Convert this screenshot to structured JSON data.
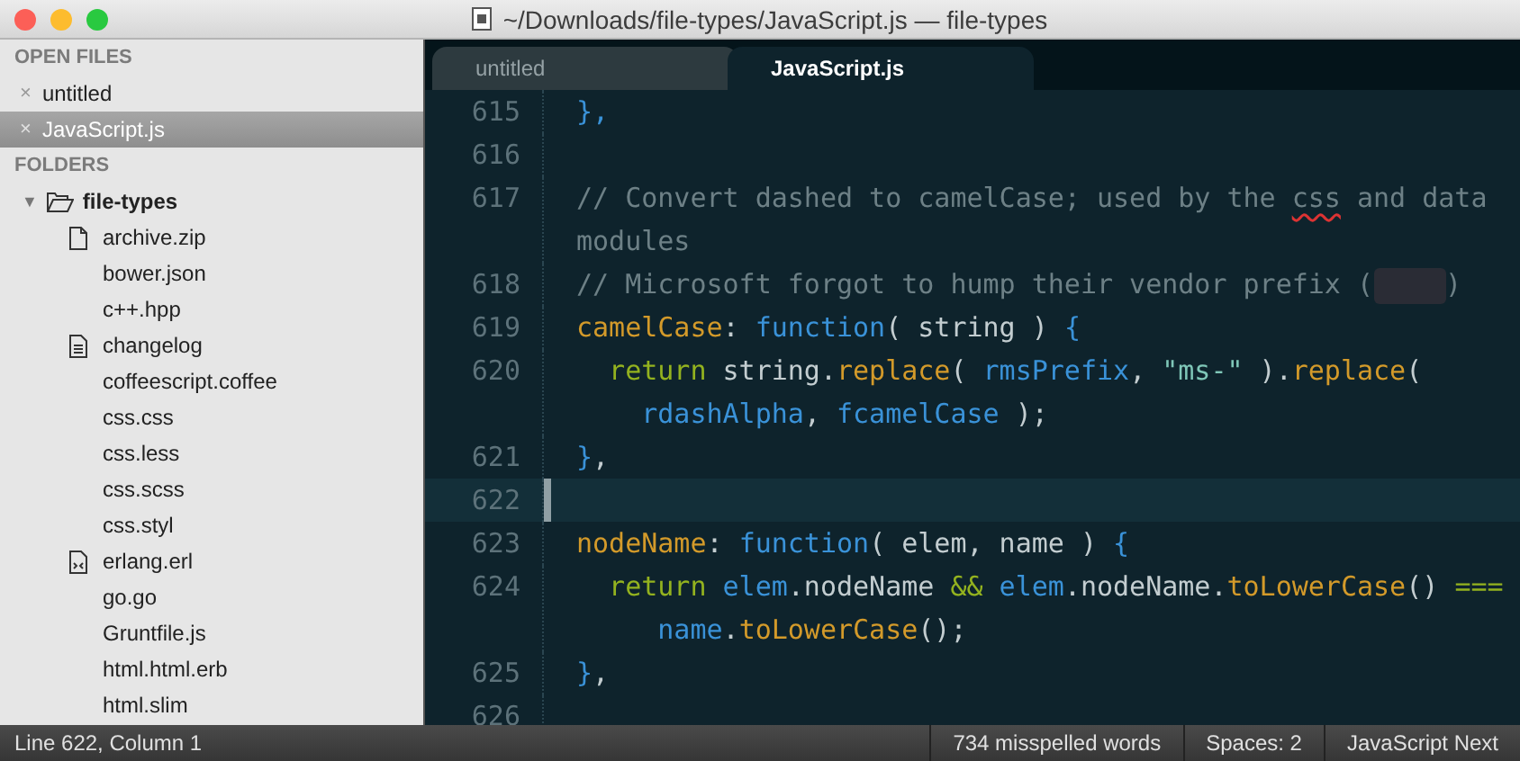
{
  "window": {
    "title": "~/Downloads/file-types/JavaScript.js — file-types"
  },
  "sidebar": {
    "open_files_header": "OPEN FILES",
    "open_files": [
      {
        "close": "×",
        "label": "untitled",
        "selected": false
      },
      {
        "close": "×",
        "label": "JavaScript.js",
        "selected": true
      }
    ],
    "folders_header": "FOLDERS",
    "folder": {
      "arrow": "▼",
      "label": "file-types",
      "expanded": true,
      "children": [
        {
          "label": "archive.zip",
          "kind": "file"
        },
        {
          "label": "bower.json",
          "kind": "plain"
        },
        {
          "label": "c++.hpp",
          "kind": "plain"
        },
        {
          "label": "changelog",
          "kind": "text"
        },
        {
          "label": "coffeescript.coffee",
          "kind": "plain"
        },
        {
          "label": "css.css",
          "kind": "plain"
        },
        {
          "label": "css.less",
          "kind": "plain"
        },
        {
          "label": "css.scss",
          "kind": "plain"
        },
        {
          "label": "css.styl",
          "kind": "plain"
        },
        {
          "label": "erlang.erl",
          "kind": "code"
        },
        {
          "label": "go.go",
          "kind": "plain"
        },
        {
          "label": "Gruntfile.js",
          "kind": "plain"
        },
        {
          "label": "html.html.erb",
          "kind": "plain"
        },
        {
          "label": "html.slim",
          "kind": "plain"
        }
      ]
    }
  },
  "tabs": [
    {
      "label": "untitled",
      "selected": false
    },
    {
      "label": "JavaScript.js",
      "selected": true
    }
  ],
  "editor": {
    "lines": [
      {
        "number": "615",
        "current": false,
        "rows": [
          {
            "tokens": [
              {
                "kind": "punct",
                "text": "},"
              }
            ]
          }
        ]
      },
      {
        "number": "616",
        "current": false,
        "rows": [
          {
            "tokens": []
          }
        ]
      },
      {
        "number": "617",
        "current": false,
        "rows": [
          {
            "tokens": [
              {
                "kind": "comment",
                "text": "// Convert dashed to camelCase; used by the "
              },
              {
                "kind": "comment",
                "text": "css",
                "misspelled": true
              },
              {
                "kind": "comment",
                "text": " and data"
              }
            ]
          },
          {
            "tokens": [
              {
                "kind": "comment",
                "text": "modules"
              }
            ]
          }
        ]
      },
      {
        "number": "618",
        "current": false,
        "rows": [
          {
            "tokens": [
              {
                "kind": "comment",
                "text": "// Microsoft forgot to hump their vendor prefix ("
              },
              {
                "kind": "blur"
              },
              {
                "kind": "comment",
                "text": ")"
              }
            ]
          }
        ]
      },
      {
        "number": "619",
        "current": false,
        "rows": [
          {
            "tokens": [
              {
                "kind": "key",
                "text": "camelCase"
              },
              {
                "kind": "plain",
                "text": ": "
              },
              {
                "kind": "fn",
                "text": "function"
              },
              {
                "kind": "plain",
                "text": "( string ) "
              },
              {
                "kind": "punct",
                "text": "{"
              }
            ]
          }
        ]
      },
      {
        "number": "620",
        "current": false,
        "rows": [
          {
            "tokens": [
              {
                "kind": "ret",
                "text": "  return"
              },
              {
                "kind": "plain",
                "text": " string."
              },
              {
                "kind": "method",
                "text": "replace"
              },
              {
                "kind": "plain",
                "text": "( "
              },
              {
                "kind": "var",
                "text": "rmsPrefix"
              },
              {
                "kind": "plain",
                "text": ", "
              },
              {
                "kind": "string",
                "text": "\"ms-\""
              },
              {
                "kind": "plain",
                "text": " )."
              },
              {
                "kind": "method",
                "text": "replace"
              },
              {
                "kind": "plain",
                "text": "("
              }
            ]
          },
          {
            "tokens": [
              {
                "kind": "var",
                "text": "    rdashAlpha"
              },
              {
                "kind": "plain",
                "text": ", "
              },
              {
                "kind": "var",
                "text": "fcamelCase"
              },
              {
                "kind": "plain",
                "text": " );"
              }
            ]
          }
        ]
      },
      {
        "number": "621",
        "current": false,
        "rows": [
          {
            "tokens": [
              {
                "kind": "punct",
                "text": "}"
              },
              {
                "kind": "plain",
                "text": ","
              }
            ]
          }
        ]
      },
      {
        "number": "622",
        "current": true,
        "rows": [
          {
            "tokens": []
          }
        ]
      },
      {
        "number": "623",
        "current": false,
        "rows": [
          {
            "tokens": [
              {
                "kind": "key",
                "text": "nodeName"
              },
              {
                "kind": "plain",
                "text": ": "
              },
              {
                "kind": "fn",
                "text": "function"
              },
              {
                "kind": "plain",
                "text": "( elem, name ) "
              },
              {
                "kind": "punct",
                "text": "{"
              }
            ]
          }
        ]
      },
      {
        "number": "624",
        "current": false,
        "rows": [
          {
            "tokens": [
              {
                "kind": "ret",
                "text": "  return"
              },
              {
                "kind": "var",
                "text": " elem"
              },
              {
                "kind": "plain",
                "text": ".nodeName "
              },
              {
                "kind": "ret",
                "text": "&&"
              },
              {
                "kind": "var",
                "text": " elem"
              },
              {
                "kind": "plain",
                "text": ".nodeName."
              },
              {
                "kind": "method",
                "text": "toLowerCase"
              },
              {
                "kind": "plain",
                "text": "() "
              },
              {
                "kind": "ret",
                "text": "==="
              }
            ]
          },
          {
            "tokens": [
              {
                "kind": "var",
                "text": "     name"
              },
              {
                "kind": "plain",
                "text": "."
              },
              {
                "kind": "method",
                "text": "toLowerCase"
              },
              {
                "kind": "plain",
                "text": "();"
              }
            ]
          }
        ]
      },
      {
        "number": "625",
        "current": false,
        "rows": [
          {
            "tokens": [
              {
                "kind": "punct",
                "text": "}"
              },
              {
                "kind": "plain",
                "text": ","
              }
            ]
          }
        ]
      },
      {
        "number": "626",
        "current": false,
        "rows": [
          {
            "tokens": []
          }
        ]
      }
    ]
  },
  "status_bar": {
    "position": "Line 622, Column 1",
    "spelling": "734 misspelled words",
    "indentation": "Spaces: 2",
    "syntax": "JavaScript Next"
  }
}
